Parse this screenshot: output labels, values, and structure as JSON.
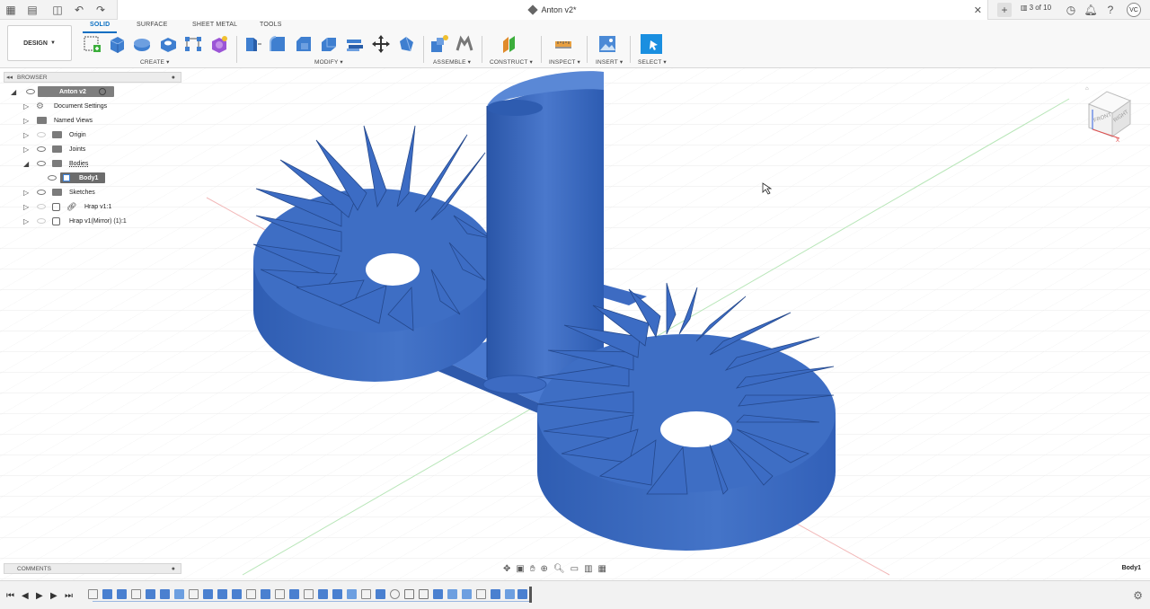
{
  "app": {
    "doc_title": "Anton v2*",
    "pages": "3 of 10",
    "user_initials": "VC"
  },
  "toolbar": {
    "workspace": "DESIGN",
    "tabs": [
      "SOLID",
      "SURFACE",
      "SHEET METAL",
      "TOOLS"
    ],
    "active_tab": "SOLID",
    "groups": [
      "CREATE",
      "MODIFY",
      "ASSEMBLE",
      "CONSTRUCT",
      "INSPECT",
      "INSERT",
      "SELECT"
    ]
  },
  "browser": {
    "title": "BROWSER",
    "root": "Anton v2",
    "items": [
      {
        "label": "Document Settings",
        "icon": "gear-icon"
      },
      {
        "label": "Named Views",
        "icon": "folder-icon"
      },
      {
        "label": "Origin",
        "icon": "folder-icon"
      },
      {
        "label": "Joints",
        "icon": "folder-icon"
      },
      {
        "label": "Bodies",
        "icon": "folder-icon"
      },
      {
        "label": "Body1",
        "icon": "body-icon"
      },
      {
        "label": "Sketches",
        "icon": "folder-icon"
      },
      {
        "label": "Hrap v1:1",
        "icon": "component-icon"
      },
      {
        "label": "Hrap v1(Mirror) (1):1",
        "icon": "component-icon"
      }
    ]
  },
  "comments": {
    "title": "COMMENTS"
  },
  "status": {
    "selection": "Body1"
  },
  "colors": {
    "accent": "#0a6fc2",
    "model": "#3366c0"
  },
  "viewcube": {
    "faces": [
      "FRONT",
      "RIGHT",
      "TOP"
    ]
  }
}
